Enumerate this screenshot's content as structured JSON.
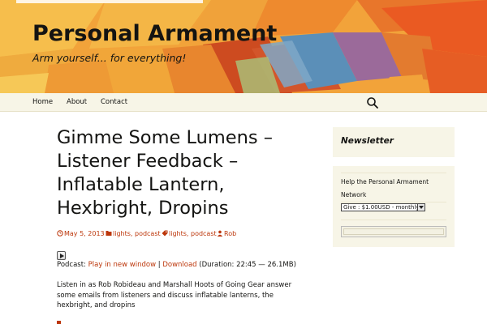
{
  "site": {
    "title": "Personal Armament",
    "description": "Arm yourself... for everything!"
  },
  "nav": {
    "items": [
      "Home",
      "About",
      "Contact"
    ],
    "search_icon": "search-icon"
  },
  "colors": {
    "accent": "#bc360a",
    "nav_bg": "#f7f5e7",
    "text": "#141412"
  },
  "post": {
    "title": "Gimme Some Lumens – Listener Feedback – Inflatable Lantern, Hexbright, Dropins",
    "date": "May 5, 2013",
    "category": "lights, podcast",
    "tags": "lights, podcast",
    "author": "Rob",
    "podcast_prefix": "Podcast:",
    "play_new_window": "Play in new window",
    "separator": "|",
    "download": "Download",
    "duration": "(Duration: 22:45 — 26.1MB)",
    "body": "Listen in as Rob Robideau and Marshall Hoots of Going Gear answer some emails from listeners and discuss inflatable lanterns, the hexbright, and dropins"
  },
  "sidebar": {
    "newsletter_title": "Newsletter",
    "donate_text": "Help the Personal Armament Network",
    "donate_option": "Give : $1.00USD - monthly"
  }
}
